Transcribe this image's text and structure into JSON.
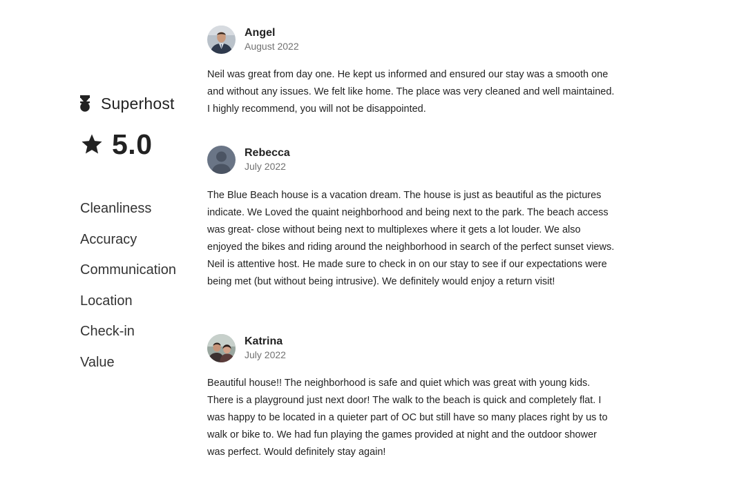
{
  "host": {
    "badge_label": "Superhost",
    "badge_icon": "superhost-icon",
    "rating_icon": "star-icon",
    "rating_value": "5.0"
  },
  "categories": [
    {
      "label": "Cleanliness"
    },
    {
      "label": "Accuracy"
    },
    {
      "label": "Communication"
    },
    {
      "label": "Location"
    },
    {
      "label": "Check-in"
    },
    {
      "label": "Value"
    }
  ],
  "reviews": [
    {
      "name": "Angel",
      "date": "August 2022",
      "text": "Neil was great from day one. He kept us informed and ensured our stay was a smooth one and without any issues. We felt like home. The place was very cleaned and well maintained. I highly recommend, you will not be disappointed."
    },
    {
      "name": "Rebecca",
      "date": "July 2022",
      "text": "The Blue Beach house is a vacation dream. The house is just as beautiful as the pictures indicate. We Loved the quaint neighborhood and being next to the park. The beach access was great- close without being next to multiplexes where it gets a lot louder. We also enjoyed the bikes and riding around the neighborhood in search of the perfect sunset views. Neil is attentive host. He made sure to check in on our stay to see if our expectations were being met (but without being intrusive). We definitely would enjoy a return visit!"
    },
    {
      "name": "Katrina",
      "date": "July 2022",
      "text": "Beautiful house!! The neighborhood is safe and quiet which was great with young kids. There is a playground just next door! The walk to the beach is quick and completely flat. I was happy to be located in a quieter part of OC but still have so many places right by us to walk or bike to. We had fun playing the games provided at night and the outdoor shower was perfect. Would definitely stay again!"
    }
  ],
  "colors": {
    "text_primary": "#222222",
    "text_secondary": "#717171",
    "background": "#ffffff"
  }
}
